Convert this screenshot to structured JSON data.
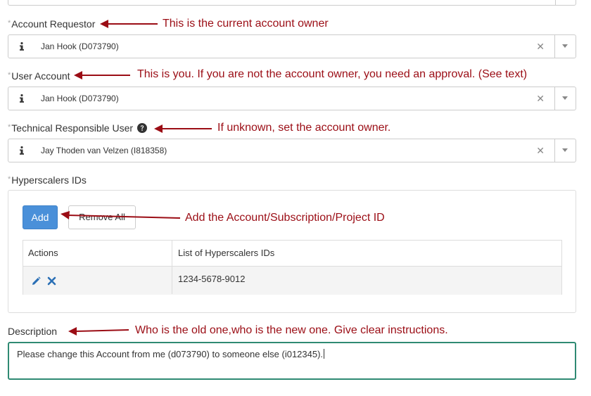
{
  "fields": {
    "account_requestor": {
      "required_mark": "*",
      "label": "Account Requestor",
      "value": "Jan Hook (D073790)",
      "clear_glyph": "✕"
    },
    "user_account": {
      "required_mark": "*",
      "label": "User Account",
      "value": "Jan Hook (D073790)",
      "clear_glyph": "✕"
    },
    "technical_responsible_user": {
      "required_mark": "*",
      "label": "Technical Responsible User",
      "value": "Jay Thoden van Velzen (I818358)",
      "clear_glyph": "✕"
    },
    "hyperscalers_ids": {
      "required_mark": "*",
      "label": "Hyperscalers IDs"
    }
  },
  "hyperscalers": {
    "add_label": "Add",
    "remove_all_label": "Remove All",
    "columns": [
      "Actions",
      "List of Hyperscalers IDs"
    ],
    "rows": [
      {
        "id": "1234-5678-9012"
      }
    ]
  },
  "description": {
    "label": "Description",
    "value": "Please change this Account from me (d073790) to someone else (i012345)."
  },
  "annotations": {
    "requestor_note": "This is the current account owner",
    "user_account_note": "This is you. If you are not the account owner, you need an approval. (See text)",
    "technical_note": "If unknown, set the account owner.",
    "add_note": "Add the Account/Subscription/Project ID",
    "description_note": "Who is the old one,who is the new one. Give clear instructions."
  },
  "colors": {
    "annotation": "#9b0d15",
    "primary_button": "#4a90d9",
    "focus_border": "#2f8a73",
    "icon_dark": "#333333",
    "icon_blue": "#2a6fb5"
  },
  "icons": {
    "info": "info-icon",
    "help": "question-circle-icon",
    "clear": "clear-icon",
    "caret": "chevron-down-icon",
    "edit": "pencil-icon",
    "delete": "close-icon"
  }
}
